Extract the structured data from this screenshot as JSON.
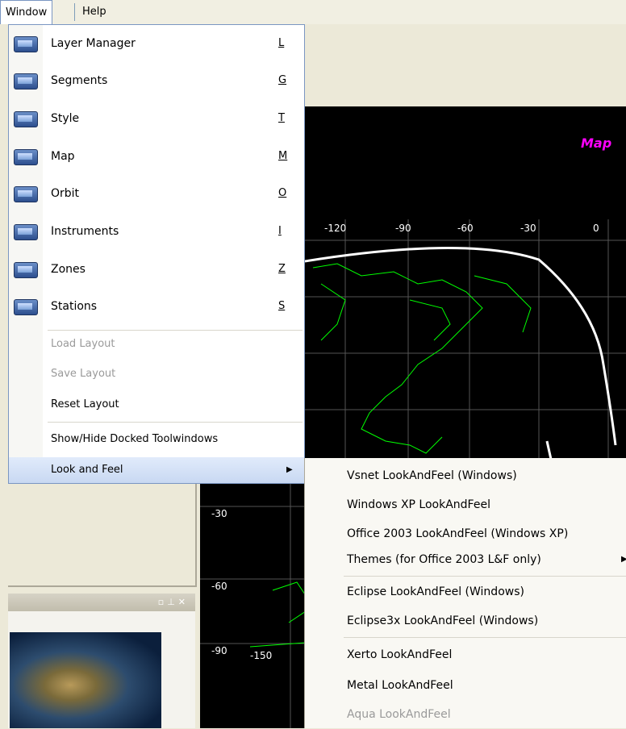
{
  "menubar": {
    "items": [
      "Window",
      "Help"
    ]
  },
  "window_menu": {
    "tool_items": [
      {
        "label": "Layer Manager",
        "key": "L"
      },
      {
        "label": "Segments",
        "key": "G"
      },
      {
        "label": "Style",
        "key": "T"
      },
      {
        "label": "Map",
        "key": "M"
      },
      {
        "label": "Orbit",
        "key": "O"
      },
      {
        "label": "Instruments",
        "key": "I"
      },
      {
        "label": "Zones",
        "key": "Z"
      },
      {
        "label": "Stations",
        "key": "S"
      }
    ],
    "load_layout": "Load Layout",
    "save_layout": "Save Layout",
    "reset_layout": "Reset Layout",
    "show_hide": "Show/Hide Docked Toolwindows",
    "look_and_feel": "Look and Feel"
  },
  "look_and_feel_submenu": {
    "items": [
      "Vsnet LookAndFeel (Windows)",
      "Windows XP LookAndFeel",
      "Office 2003 LookAndFeel (Windows XP)",
      "Themes (for Office 2003 L&F only)",
      "Eclipse LookAndFeel (Windows)",
      "Eclipse3x LookAndFeel (Windows)",
      "Xerto LookAndFeel",
      "Metal LookAndFeel",
      "Aqua LookAndFeel"
    ]
  },
  "map": {
    "title": "Map",
    "x_ticks": [
      "-120",
      "-90",
      "-60",
      "-30",
      "0"
    ],
    "y_ticks": [
      "-30",
      "-60",
      "-90"
    ],
    "bottom_tick": "-150"
  },
  "colors": {
    "menu_border": "#7a96c2",
    "highlight": "#c8d8f2",
    "map_bg": "#000000",
    "map_title": "#ff00ff",
    "coast": "#00ff00"
  }
}
